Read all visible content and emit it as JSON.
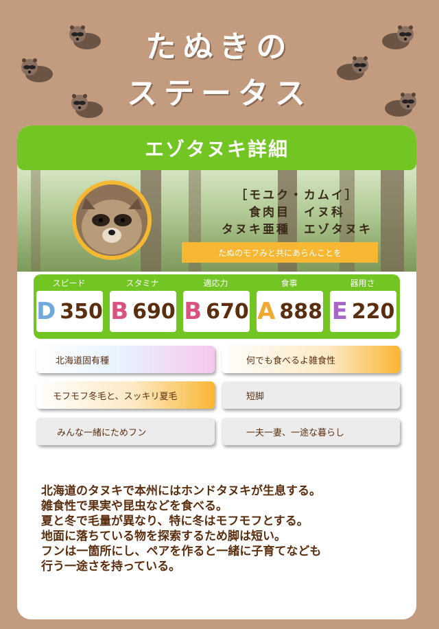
{
  "title": {
    "line1": "たぬきの",
    "line2": "ステータス"
  },
  "card": {
    "heading": "エゾタヌキ詳細",
    "info": {
      "ainu_name": "［モユク・カムイ］",
      "order_family": "食肉目　イヌ科",
      "species": "タヌキ亜種　エゾタヌキ"
    },
    "motto": "たぬのモフみと共にあらんことを"
  },
  "stats": [
    {
      "label": "スピード",
      "grade": "D",
      "value": "350",
      "color": "#6fa8dc"
    },
    {
      "label": "スタミナ",
      "grade": "B",
      "value": "690",
      "color": "#d9537e"
    },
    {
      "label": "適応力",
      "grade": "B",
      "value": "670",
      "color": "#d9537e"
    },
    {
      "label": "食事",
      "grade": "A",
      "value": "888",
      "color": "#f0a830"
    },
    {
      "label": "器用さ",
      "grade": "E",
      "value": "220",
      "color": "#a865c9"
    }
  ],
  "traits": [
    "北海道固有種",
    "何でも食べるよ雑食性",
    "モフモフ冬毛と、スッキリ夏毛",
    "短脚",
    "みんな一緒にためフン",
    "一夫一妻、一途な暮らし"
  ],
  "description": [
    "北海道のタヌキで本州にはホンドタヌキが生息する。",
    "雑食性で果実や昆虫などを食べる。",
    "夏と冬で毛量が異なり、特に冬はモフモフとする。",
    "地面に落ちている物を探索するため脚は短い。",
    "フンは一箇所にし、ペアを作ると一緒に子育てなども",
    "行う一途さを持っている。"
  ]
}
